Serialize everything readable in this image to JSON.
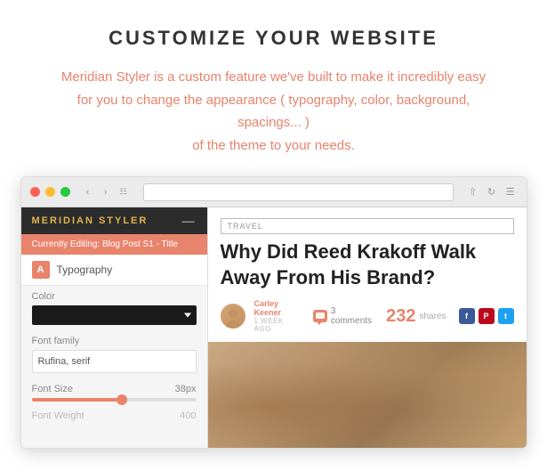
{
  "heading": "CUSTOMIZE YOUR WEBSITE",
  "description": {
    "line1": "Meridian Styler is a custom feature we've built to make it incredibly easy",
    "line2": "for you to change the appearance ( typography, color, background, spacings... )",
    "line3": "of the theme to your needs."
  },
  "browser": {
    "styler": {
      "title": "MERIDIAN STYLER",
      "editing_label": "Currently Editing: Blog Post S1 - Title",
      "type_icon": "A",
      "typography_label": "Typography",
      "color_label": "Color",
      "font_family_label": "Font family",
      "font_family_value": "Rufina, serif",
      "font_size_label": "Font Size",
      "font_size_value": "38px",
      "font_weight_label": "Font Weight",
      "font_weight_value": "400"
    },
    "article": {
      "tag": "TRAVEL",
      "title": "Why Did Reed Krakoff Walk Away From His Brand?",
      "author_name": "Carley Keener",
      "author_time": "1 week ago",
      "comments_count": "3 comments",
      "shares_number": "232",
      "shares_label": "shares"
    }
  }
}
